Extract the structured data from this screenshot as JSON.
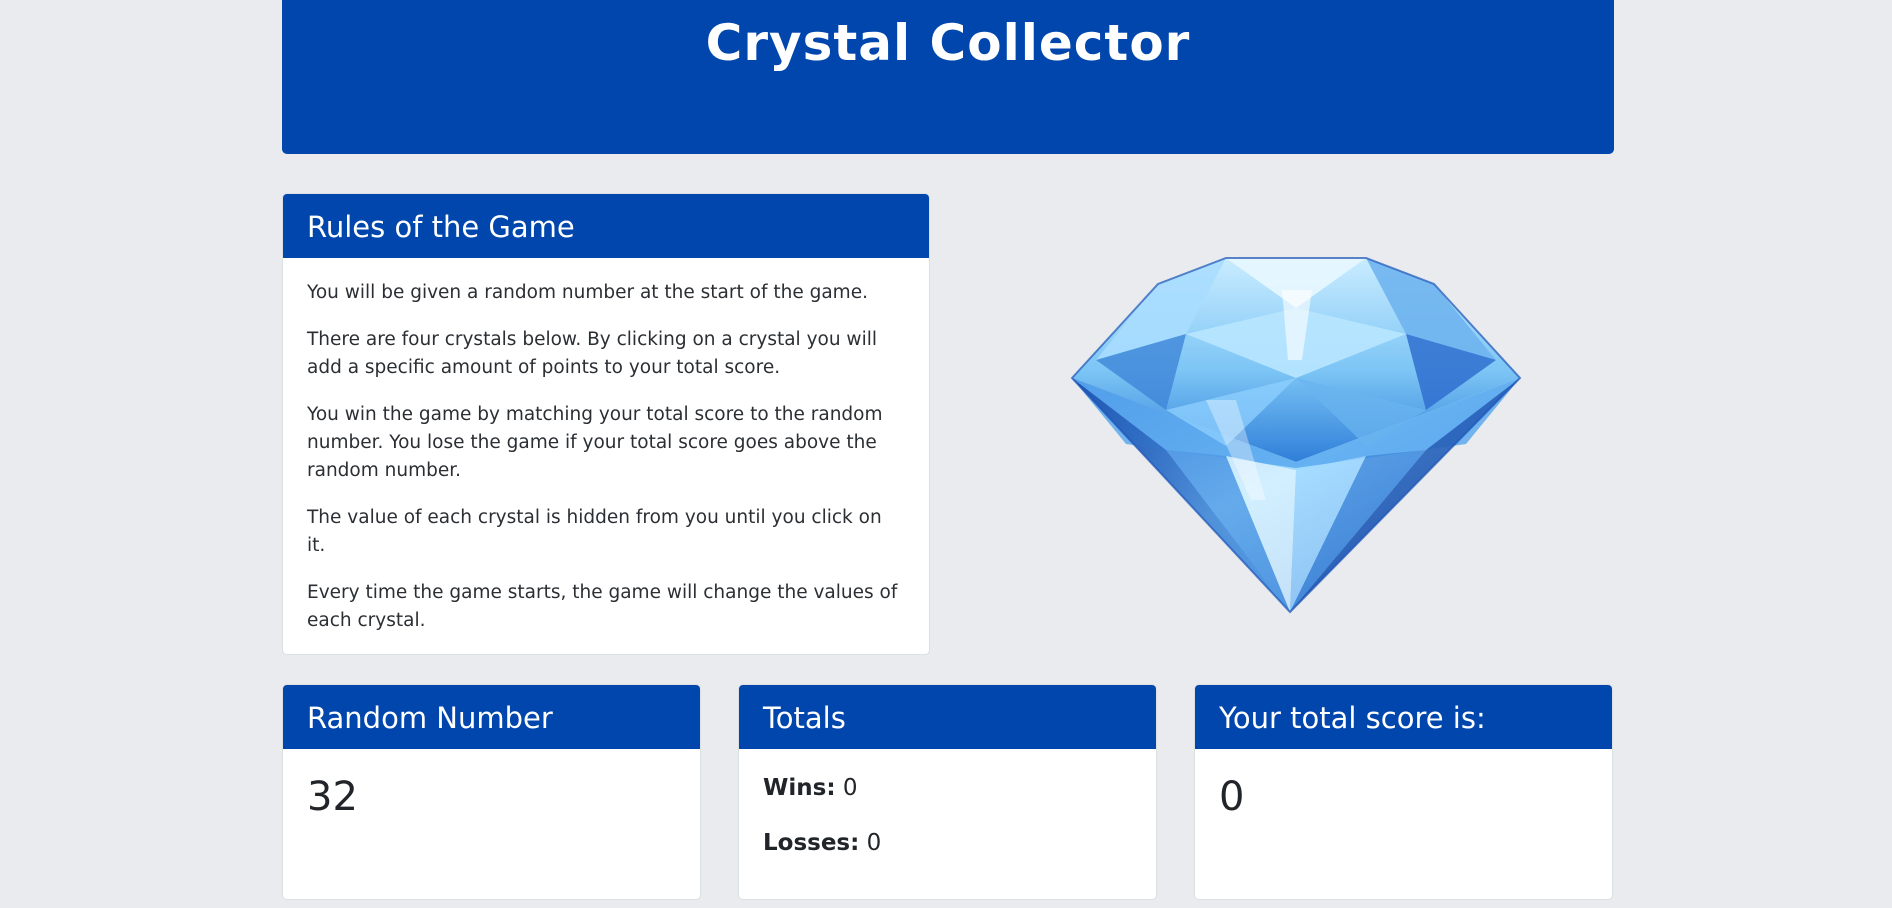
{
  "header": {
    "title": "Crystal Collector"
  },
  "rules": {
    "title": "Rules of the Game",
    "paragraphs": [
      "You will be given a random number at the start of the game.",
      "There are four crystals below. By clicking on a crystal you will add a specific amount of points to your total score.",
      "You win the game by matching your total score to the random number. You lose the game if your total score goes above the random number.",
      "The value of each crystal is hidden from you until you click on it.",
      "Every time the game starts, the game will change the values of each crystal."
    ]
  },
  "crystal_image": {
    "icon": "blue-diamond-crystal"
  },
  "random_number": {
    "title": "Random Number",
    "value": "32"
  },
  "totals": {
    "title": "Totals",
    "wins_label": "Wins:",
    "wins_value": "0",
    "losses_label": "Losses:",
    "losses_value": "0"
  },
  "score": {
    "title": "Your total score is:",
    "value": "0"
  },
  "colors": {
    "brand": "#0046ad",
    "background": "#e9ebee",
    "card": "#ffffff"
  }
}
